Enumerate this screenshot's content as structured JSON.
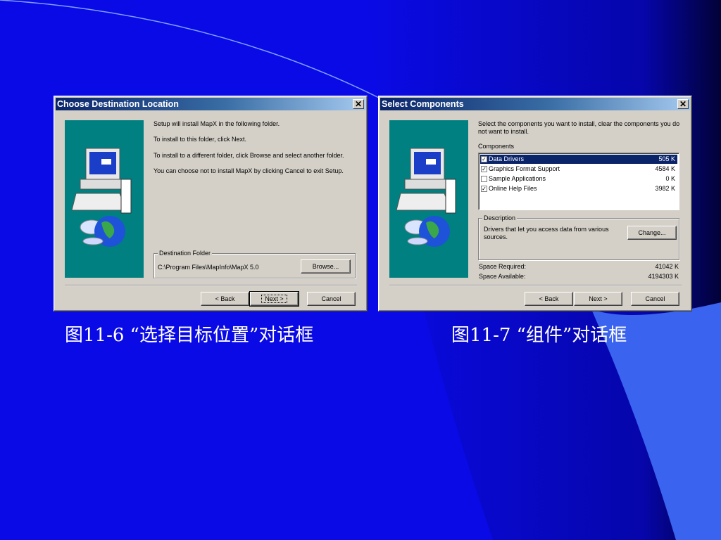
{
  "dialog1": {
    "title": "Choose Destination Location",
    "close_glyph": "✕",
    "line1": "Setup will install MapX in the following folder.",
    "line2": "To install to this folder, click Next.",
    "line3": "To install to a different folder, click Browse and select another folder.",
    "line4": "You can choose not to install MapX by clicking Cancel to exit Setup.",
    "dest_group": "Destination Folder",
    "dest_path": "C:\\Program Files\\MapInfo\\MapX 5.0",
    "browse": "Browse...",
    "back": "< Back",
    "next": "Next >",
    "cancel": "Cancel"
  },
  "dialog2": {
    "title": "Select Components",
    "close_glyph": "✕",
    "intro": "Select the components you want to install, clear the components you do not want to install.",
    "components_label": "Components",
    "components": [
      {
        "name": "Data Drivers",
        "size": "505 K",
        "checked": true
      },
      {
        "name": "Graphics Format Support",
        "size": "4584 K",
        "checked": true
      },
      {
        "name": "Sample Applications",
        "size": "0 K",
        "checked": false
      },
      {
        "name": "Online Help Files",
        "size": "3982 K",
        "checked": true
      }
    ],
    "description_group": "Description",
    "description_text": "Drivers that let you access data from various sources.",
    "change": "Change...",
    "space_required_label": "Space Required:",
    "space_required_value": "41042 K",
    "space_available_label": "Space Available:",
    "space_available_value": "4194303 K",
    "back": "< Back",
    "next": "Next >",
    "cancel": "Cancel"
  },
  "captions": {
    "left": "图11-6 “选择目标位置”对话框",
    "right": "图11-7 “组件”对话框"
  },
  "colors": {
    "background": "#0a0ae6",
    "titlebar_start": "#0a246a",
    "dialog_face": "#d4d0c8",
    "art_teal": "#008080"
  }
}
